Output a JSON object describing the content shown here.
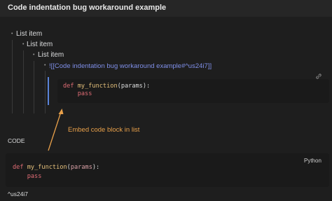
{
  "page": {
    "title": "Code indentation bug workaround example"
  },
  "list": {
    "items": [
      {
        "label": "List item"
      },
      {
        "label": "List item"
      },
      {
        "label": "List item"
      }
    ],
    "embed_link": "![[Code indentation bug workaround example#^us24i7]]"
  },
  "embedded_code": {
    "line1": {
      "kw": "def",
      "fn": "my_function",
      "args": "(params):"
    },
    "line2": {
      "kw": "pass"
    }
  },
  "annotation": {
    "text": "Embed code block in list",
    "color": "#e8a04a"
  },
  "code_section": {
    "label": "CODE",
    "language": "Python",
    "line1": {
      "kw": "def",
      "fn": "my_function",
      "open": "(",
      "param": "params",
      "close": "):"
    },
    "line2": {
      "kw": "pass"
    },
    "block_id": "^us24i7"
  },
  "icons": {
    "link": "link-icon",
    "arrow": "arrow-icon"
  }
}
